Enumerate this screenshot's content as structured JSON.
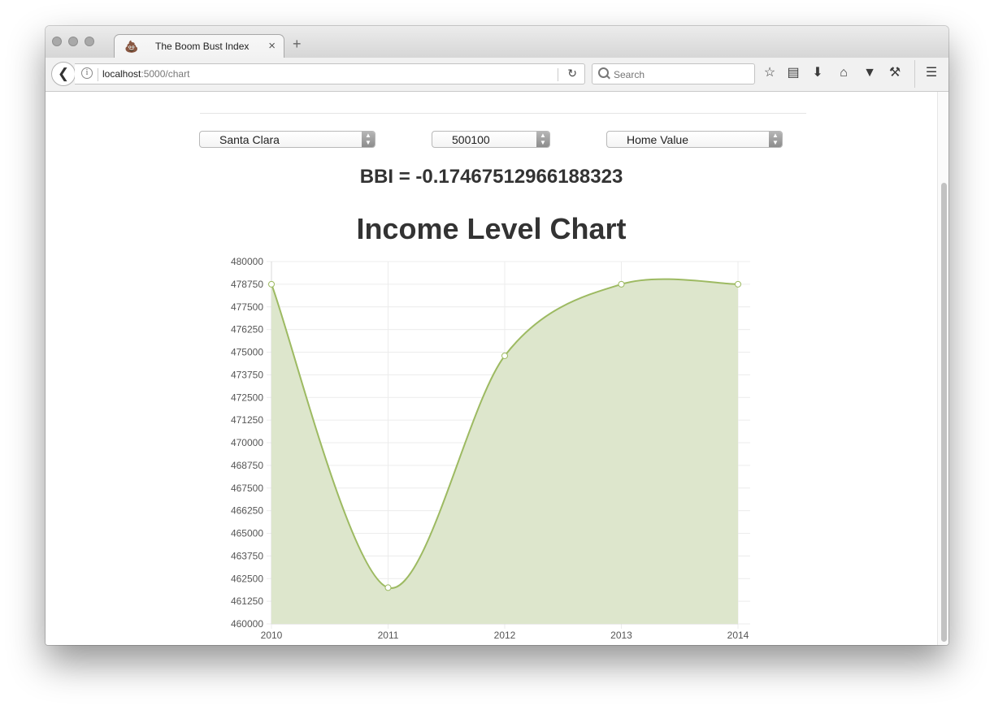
{
  "browser": {
    "tab_title": "The Boom Bust Index",
    "tab_icon": "💩",
    "tab_close": "×",
    "new_tab": "+",
    "url_host": "localhost",
    "url_path": ":5000/chart",
    "search_placeholder": "Search"
  },
  "toolbar_icons": [
    "bookmark-star-icon",
    "reading-list-icon",
    "downloads-icon",
    "home-icon",
    "pocket-icon",
    "developer-tools-icon",
    "hamburger-menu-icon"
  ],
  "filters": {
    "county": "Santa Clara",
    "zip": "500100",
    "metric": "Home Value"
  },
  "bbi_text": "BBI = -0.17467512966188323",
  "chart_data": {
    "type": "area",
    "title": "Income Level Chart",
    "categories": [
      "2010",
      "2011",
      "2012",
      "2013",
      "2014"
    ],
    "series": [
      {
        "values": [
          478750,
          462000,
          474800,
          478750,
          478750
        ],
        "color": "#9dba62",
        "fill": "#dde6cc"
      }
    ],
    "ylim": [
      460000,
      480000
    ],
    "yticks": [
      480000,
      478750,
      477500,
      476250,
      475000,
      473750,
      472500,
      471250,
      470000,
      468750,
      467500,
      466250,
      465000,
      463750,
      462500,
      461250,
      460000
    ],
    "grid": true,
    "legend": "none"
  }
}
